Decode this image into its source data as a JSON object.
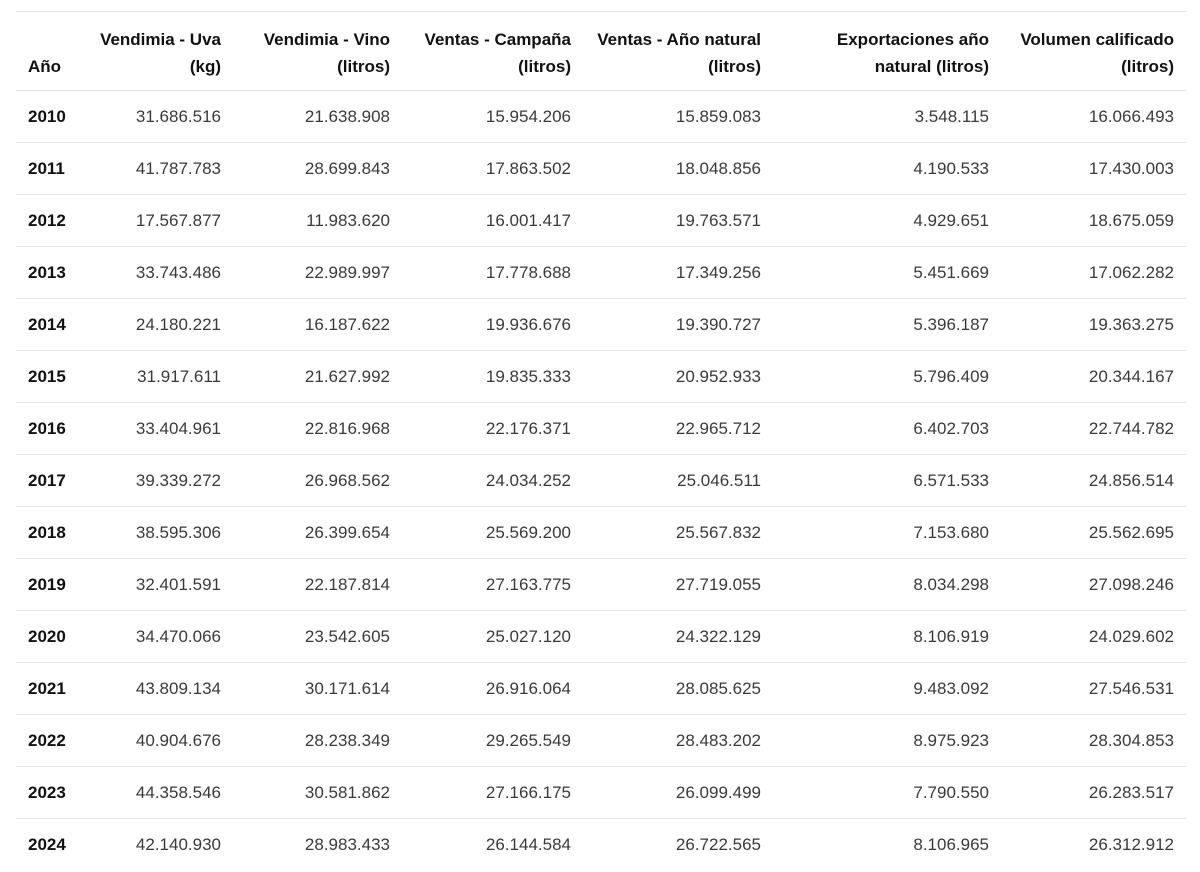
{
  "table": {
    "headers": [
      [
        "Año"
      ],
      [
        "Vendimia - Uva",
        "(kg)"
      ],
      [
        "Vendimia - Vino",
        "(litros)"
      ],
      [
        "Ventas - Campaña",
        "(litros)"
      ],
      [
        "Ventas - Año natural",
        "(litros)"
      ],
      [
        "Exportaciones año",
        "natural (litros)"
      ],
      [
        "Volumen calificado",
        "(litros)"
      ]
    ],
    "rows": [
      [
        "2010",
        "31.686.516",
        "21.638.908",
        "15.954.206",
        "15.859.083",
        "3.548.115",
        "16.066.493"
      ],
      [
        "2011",
        "41.787.783",
        "28.699.843",
        "17.863.502",
        "18.048.856",
        "4.190.533",
        "17.430.003"
      ],
      [
        "2012",
        "17.567.877",
        "11.983.620",
        "16.001.417",
        "19.763.571",
        "4.929.651",
        "18.675.059"
      ],
      [
        "2013",
        "33.743.486",
        "22.989.997",
        "17.778.688",
        "17.349.256",
        "5.451.669",
        "17.062.282"
      ],
      [
        "2014",
        "24.180.221",
        "16.187.622",
        "19.936.676",
        "19.390.727",
        "5.396.187",
        "19.363.275"
      ],
      [
        "2015",
        "31.917.611",
        "21.627.992",
        "19.835.333",
        "20.952.933",
        "5.796.409",
        "20.344.167"
      ],
      [
        "2016",
        "33.404.961",
        "22.816.968",
        "22.176.371",
        "22.965.712",
        "6.402.703",
        "22.744.782"
      ],
      [
        "2017",
        "39.339.272",
        "26.968.562",
        "24.034.252",
        "25.046.511",
        "6.571.533",
        "24.856.514"
      ],
      [
        "2018",
        "38.595.306",
        "26.399.654",
        "25.569.200",
        "25.567.832",
        "7.153.680",
        "25.562.695"
      ],
      [
        "2019",
        "32.401.591",
        "22.187.814",
        "27.163.775",
        "27.719.055",
        "8.034.298",
        "27.098.246"
      ],
      [
        "2020",
        "34.470.066",
        "23.542.605",
        "25.027.120",
        "24.322.129",
        "8.106.919",
        "24.029.602"
      ],
      [
        "2021",
        "43.809.134",
        "30.171.614",
        "26.916.064",
        "28.085.625",
        "9.483.092",
        "27.546.531"
      ],
      [
        "2022",
        "40.904.676",
        "28.238.349",
        "29.265.549",
        "28.483.202",
        "8.975.923",
        "28.304.853"
      ],
      [
        "2023",
        "44.358.546",
        "30.581.862",
        "27.166.175",
        "26.099.499",
        "7.790.550",
        "26.283.517"
      ],
      [
        "2024",
        "42.140.930",
        "28.983.433",
        "26.144.584",
        "26.722.565",
        "8.106.965",
        "26.312.912"
      ]
    ]
  }
}
